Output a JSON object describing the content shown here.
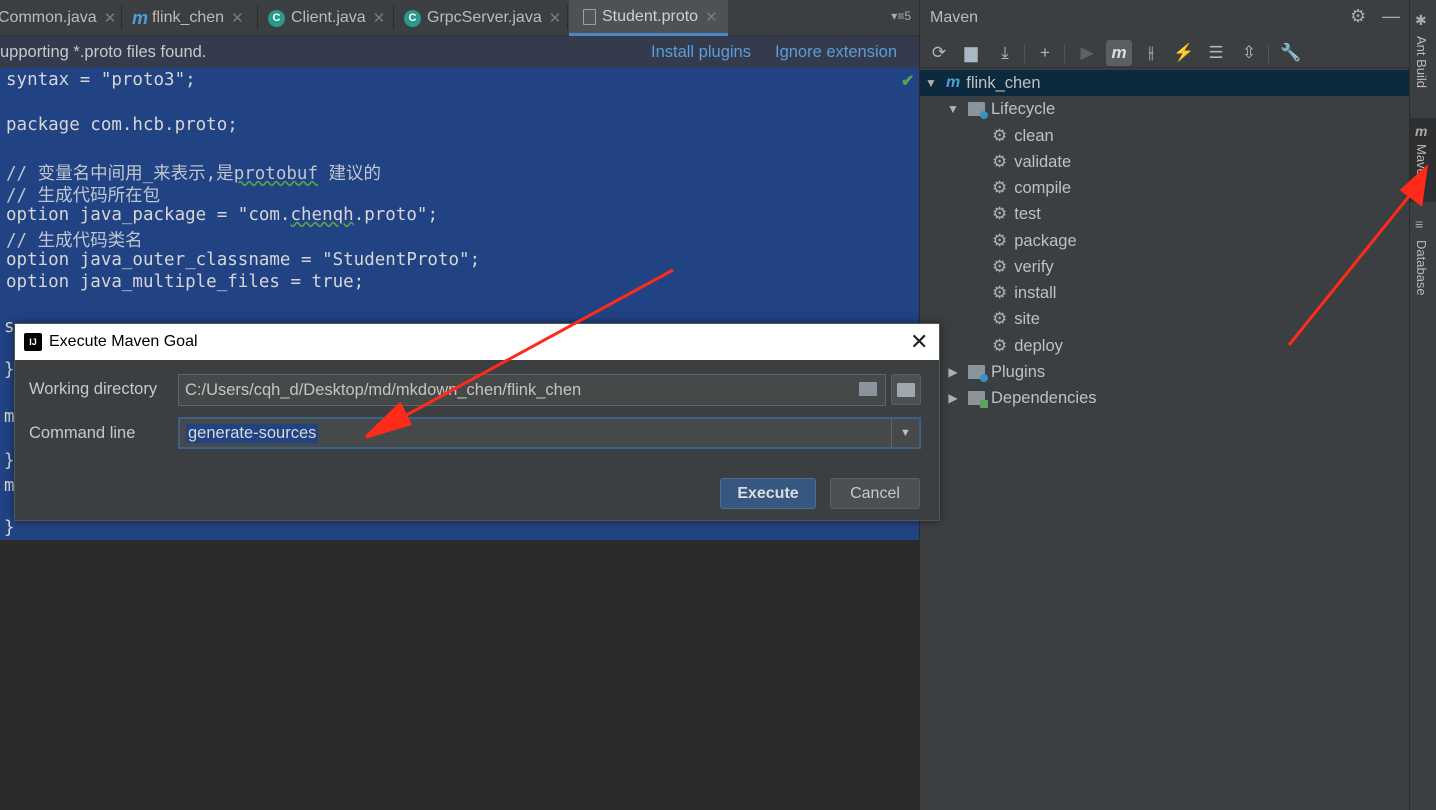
{
  "tabs": [
    {
      "label": "Common.java",
      "icon": "java-class-icon"
    },
    {
      "label": "flink_chen",
      "icon": "maven-icon"
    },
    {
      "label": "Client.java",
      "icon": "java-class-icon"
    },
    {
      "label": "GrpcServer.java",
      "icon": "java-class-icon"
    },
    {
      "label": "Student.proto",
      "icon": "file-icon",
      "active": true
    }
  ],
  "tab_overflow": "▾≡5",
  "notice": {
    "text": "upporting *.proto files found.",
    "install": "Install plugins",
    "ignore": "Ignore extension"
  },
  "code_lines": [
    "syntax = \"proto3\";",
    "",
    "package com.hcb.proto;",
    "",
    "// 变量名中间用_来表示,是",
    "// 生成代码所在包",
    "option java_package = \"com.",
    "// 生成代码类名",
    "option java_outer_classname = \"StudentProto\";",
    "option java_multiple_files = true;"
  ],
  "code_fragments": {
    "line5_word": "protobuf",
    "line5_tail": " 建议的",
    "line7_word": "chenqh",
    "line7_tail": ".proto\";"
  },
  "peek_chars": [
    "s",
    "}",
    "m",
    "}",
    "m",
    "}"
  ],
  "maven": {
    "title": "Maven",
    "project": "flink_chen",
    "lifecycle": "Lifecycle",
    "goals": [
      "clean",
      "validate",
      "compile",
      "test",
      "package",
      "verify",
      "install",
      "site",
      "deploy"
    ],
    "plugins": "Plugins",
    "dependencies": "Dependencies"
  },
  "side_strip": {
    "ant": "Ant Build",
    "maven": "Maven",
    "database": "Database"
  },
  "dialog": {
    "title": "Execute Maven Goal",
    "working_dir_label": "Working directory",
    "working_dir_value": "C:/Users/cqh_d/Desktop/md/mkdown_chen/flink_chen",
    "command_label": "Command line",
    "command_value": "generate-sources",
    "execute": "Execute",
    "cancel": "Cancel"
  },
  "colors": {
    "selection": "#214283",
    "accent_blue": "#4a88c7",
    "annotation_red": "#ff2a1a"
  }
}
